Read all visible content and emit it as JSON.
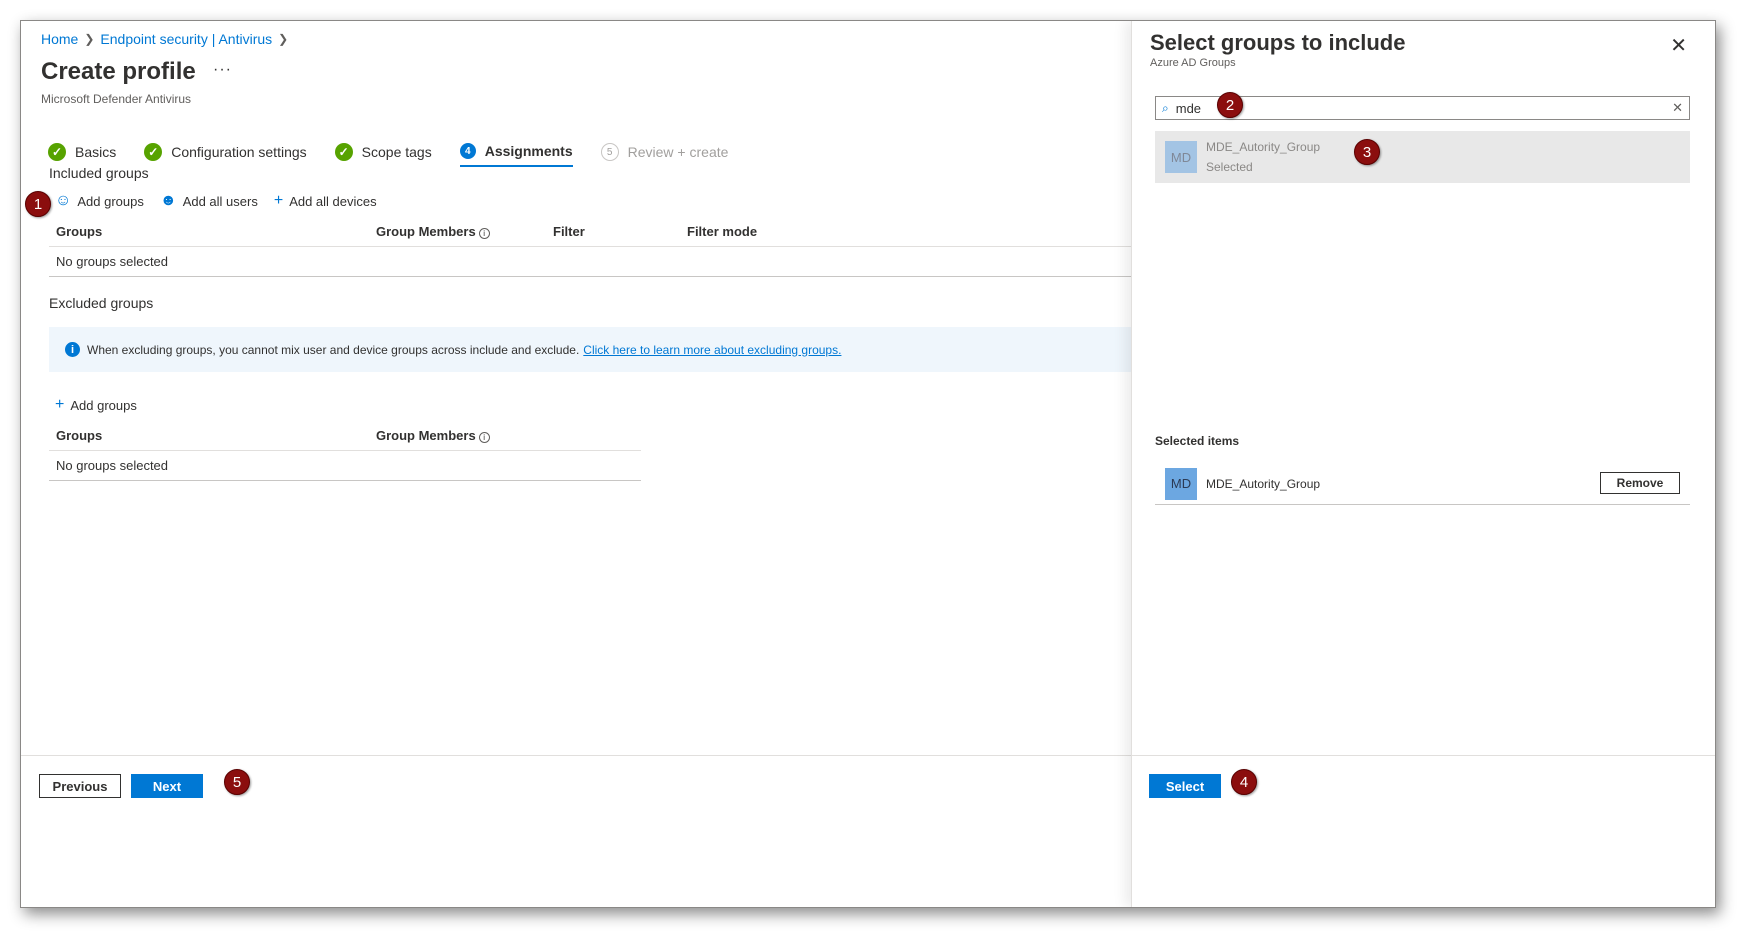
{
  "breadcrumb": {
    "home": "Home",
    "section": "Endpoint security | Antivirus"
  },
  "page": {
    "title": "Create profile",
    "more": "···",
    "subtitle": "Microsoft Defender Antivirus"
  },
  "steps": [
    {
      "label": "Basics",
      "status": "complete"
    },
    {
      "label": "Configuration settings",
      "status": "complete"
    },
    {
      "label": "Scope tags",
      "status": "complete"
    },
    {
      "label": "Assignments",
      "number": "4",
      "status": "active"
    },
    {
      "label": "Review + create",
      "number": "5",
      "status": "inactive"
    }
  ],
  "included": {
    "label": "Included groups",
    "actions": {
      "add_groups": "Add groups",
      "add_all_users": "Add all users",
      "add_all_devices": "Add all devices"
    },
    "columns": {
      "groups": "Groups",
      "members": "Group Members",
      "filter": "Filter",
      "filter_mode": "Filter mode"
    },
    "empty": "No groups selected"
  },
  "excluded": {
    "label": "Excluded groups",
    "banner_text": "When excluding groups, you cannot mix user and device groups across include and exclude.",
    "banner_link": "Click here to learn more about excluding groups.",
    "add_groups": "Add groups",
    "columns": {
      "groups": "Groups",
      "members": "Group Members"
    },
    "empty": "No groups selected"
  },
  "footer": {
    "previous": "Previous",
    "next": "Next"
  },
  "panel": {
    "title": "Select groups to include",
    "subtitle": "Azure AD Groups",
    "search_value": "mde",
    "result": {
      "initials": "MD",
      "name": "MDE_Autority_Group",
      "state": "Selected"
    },
    "selected_title": "Selected items",
    "selected_item": {
      "initials": "MD",
      "name": "MDE_Autority_Group",
      "remove": "Remove"
    },
    "select_button": "Select"
  },
  "callouts": [
    "1",
    "2",
    "3",
    "4",
    "5"
  ],
  "colors": {
    "accent": "#0078d4",
    "success": "#57a300",
    "callout": "#8b0e0e"
  }
}
